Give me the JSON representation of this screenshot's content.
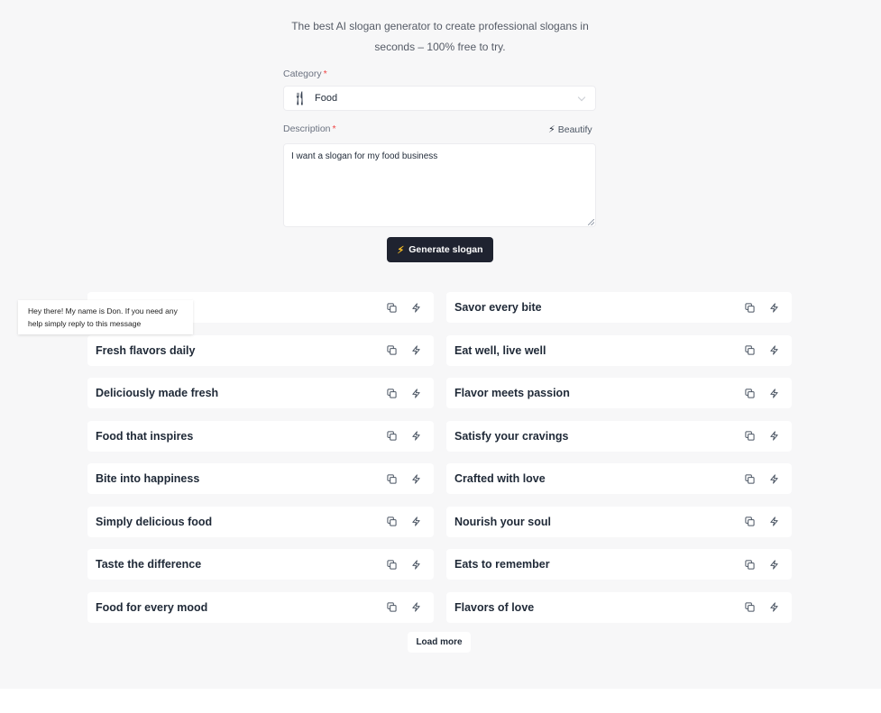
{
  "header": {
    "tagline": "The best AI slogan generator to create professional slogans in seconds – 100% free to try."
  },
  "form": {
    "category_label": "Category",
    "required_mark": "*",
    "category_value": "Food",
    "category_icon": "fork-knife-icon",
    "description_label": "Description",
    "beautify_label": "Beautify",
    "description_value": "I want a slogan for my food business",
    "generate_label": "Generate slogan"
  },
  "chat": {
    "message": "Hey there! My name is Don. If you need any help simply reply to this message"
  },
  "slogans": [
    {
      "text": "Savor every bite"
    },
    {
      "text": "Fresh flavors daily"
    },
    {
      "text": "Eat well, live well"
    },
    {
      "text": "Deliciously made fresh"
    },
    {
      "text": "Flavor meets passion"
    },
    {
      "text": "Food that inspires"
    },
    {
      "text": "Satisfy your cravings"
    },
    {
      "text": "Bite into happiness"
    },
    {
      "text": "Crafted with love"
    },
    {
      "text": "Simply delicious food"
    },
    {
      "text": "Nourish your soul"
    },
    {
      "text": "Taste the difference"
    },
    {
      "text": "Eats to remember"
    },
    {
      "text": "Food for every mood"
    },
    {
      "text": "Flavors of love"
    }
  ],
  "load_more_label": "Load more",
  "colors": {
    "page_bg": "#f7f7f8",
    "primary_button": "#1f2330",
    "bolt_accent": "#fbbf24",
    "required": "#ef4444"
  }
}
